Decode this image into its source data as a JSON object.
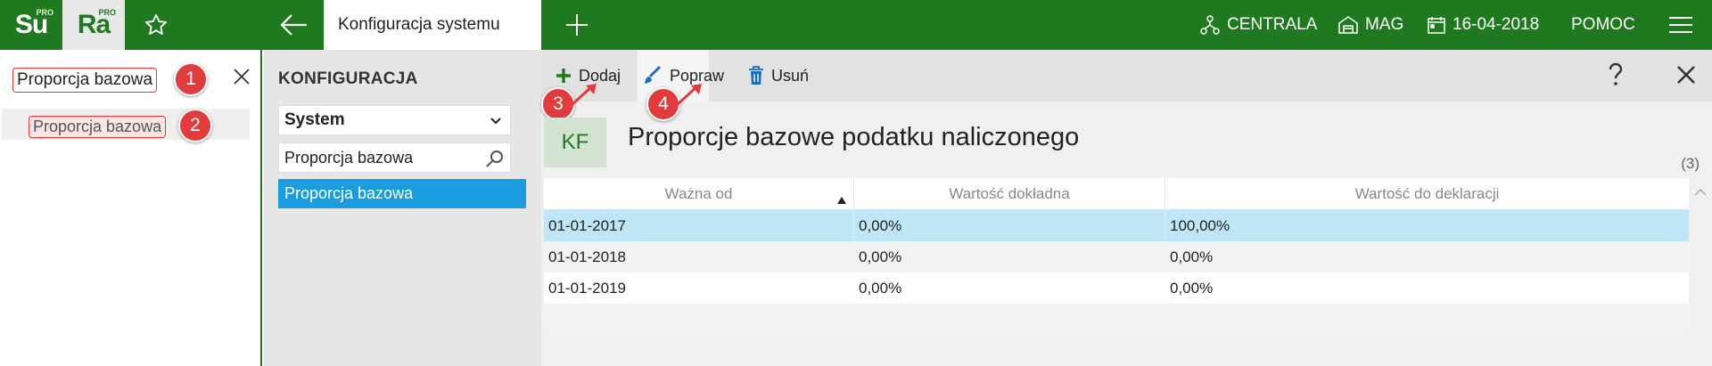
{
  "topbar": {
    "app1": {
      "letters": "Su",
      "badge": "PRO"
    },
    "app2": {
      "letters": "Ra",
      "badge": "PRO"
    },
    "favorites_icon": "star-icon",
    "back_icon": "arrow-left-icon",
    "active_tab": "Konfiguracja systemu",
    "add_tab_icon": "plus-icon",
    "branch": "CENTRALA",
    "warehouse": "MAG",
    "date": "16-04-2018",
    "help": "POMOC",
    "menu_icon": "hamburger-icon",
    "brand_color": "#1f7a1f"
  },
  "search": {
    "value": "Proporcja bazowa",
    "result": "Proporcja bazowa"
  },
  "callouts": [
    "1",
    "2",
    "3",
    "4"
  ],
  "config": {
    "title": "KONFIGURACJA",
    "group": "System",
    "filter_value": "Proporcja bazowa",
    "selected_item": "Proporcja bazowa",
    "selection_color": "#1a9ce0"
  },
  "toolbar": {
    "add": "Dodaj",
    "edit": "Popraw",
    "delete": "Usuń",
    "help_icon": "question-icon",
    "close_icon": "close-icon"
  },
  "content": {
    "tile": "KF",
    "title": "Proporcje bazowe podatku naliczonego",
    "count": "(3)",
    "columns": [
      "Ważna od",
      "Wartość dokładna",
      "Wartość do deklaracji"
    ],
    "rows": [
      [
        "01-01-2017",
        "0,00%",
        "100,00%"
      ],
      [
        "01-01-2018",
        "0,00%",
        "0,00%"
      ],
      [
        "01-01-2019",
        "0,00%",
        "0,00%"
      ]
    ],
    "selected_row_color": "#bfe6f7"
  }
}
